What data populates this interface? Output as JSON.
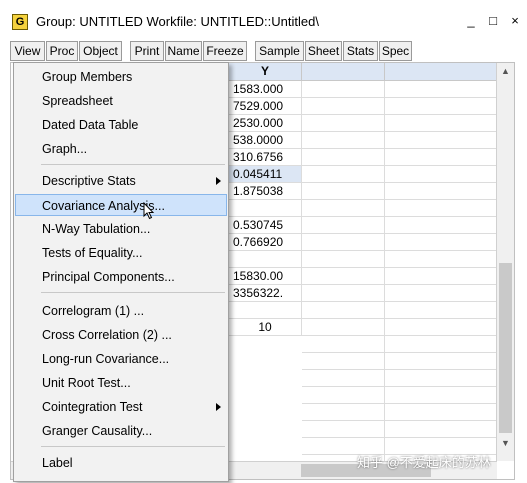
{
  "window": {
    "icon_letter": "G",
    "title": "Group: UNTITLED   Workfile: UNTITLED::Untitled\\",
    "controls": [
      "_",
      "□",
      "×"
    ]
  },
  "toolbar": [
    "View",
    "Proc",
    "Object",
    "Print",
    "Name",
    "Freeze",
    "Sample",
    "Sheet",
    "Stats",
    "Spec"
  ],
  "grid": {
    "column_header": "Y",
    "values": [
      "1583.000",
      "7529.000",
      "2530.000",
      "538.0000",
      "310.6756",
      "0.045411",
      "1.875038",
      "",
      "0.530745",
      "0.766920",
      "",
      "15830.00",
      "3356322.",
      "",
      "10"
    ]
  },
  "menu": {
    "items": [
      {
        "label": "Group Members",
        "submenu": false
      },
      {
        "label": "Spreadsheet",
        "submenu": false
      },
      {
        "label": "Dated Data Table",
        "submenu": false
      },
      {
        "label": "Graph...",
        "submenu": false
      },
      {
        "label": "Descriptive Stats",
        "submenu": true
      },
      {
        "label": "Covariance Analysis...",
        "submenu": false,
        "highlighted": true
      },
      {
        "label": "N-Way Tabulation...",
        "submenu": false
      },
      {
        "label": "Tests of Equality...",
        "submenu": false
      },
      {
        "label": "Principal Components...",
        "submenu": false
      },
      {
        "label": "Correlogram (1) ...",
        "submenu": false
      },
      {
        "label": "Cross Correlation (2) ...",
        "submenu": false
      },
      {
        "label": "Long-run Covariance...",
        "submenu": false
      },
      {
        "label": "Unit Root Test...",
        "submenu": false
      },
      {
        "label": "Cointegration Test",
        "submenu": true
      },
      {
        "label": "Granger Causality...",
        "submenu": false
      },
      {
        "label": "Label",
        "submenu": false
      }
    ]
  },
  "watermark": "知乎 @不爱起床的苏林",
  "colors": {
    "menu_highlight": "#cfe3fb",
    "header_bg": "#dce6f4",
    "selected_cell": "#dce6f4"
  }
}
